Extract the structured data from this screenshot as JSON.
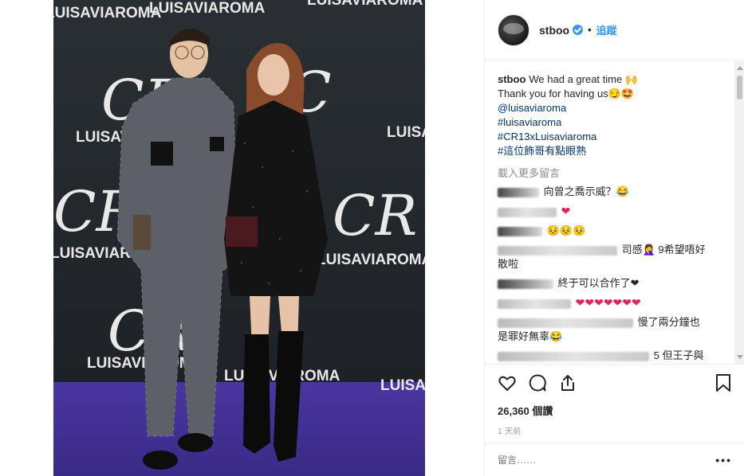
{
  "photo": {
    "brand_text": "LUISAVIAROMA",
    "logo_text": "CR"
  },
  "post": {
    "username": "stboo",
    "separator": "•",
    "follow_label": "追蹤",
    "caption_user": "stboo",
    "caption_line1": "We had a great time 🙌",
    "caption_line2": "Thank you for having us😏🤩",
    "mentions": [
      "@luisaviaroma",
      "#luisaviaroma",
      "#CR13xLuisaviaroma",
      "#這位飾哥有點眼熟"
    ],
    "load_more_label": "載入更多留言"
  },
  "comments": [
    {
      "text": "向曾之喬示威？😂"
    },
    {
      "text": "❤"
    },
    {
      "text": "😣😣😣"
    },
    {
      "text": "司感🤦‍♀️ 9希望唔好",
      "text2": "散啦"
    },
    {
      "text": "終于可以合作了❤"
    },
    {
      "text": "❤❤❤❤❤❤❤"
    },
    {
      "text": "慢了兩分鐘也",
      "text2": "是罪好無辜😂"
    },
    {
      "text": "5 但王子與"
    }
  ],
  "stats": {
    "likes": "26,360 個讚",
    "time": "1 天前"
  },
  "comment_input": {
    "placeholder": "留言……",
    "more_label": "•••"
  },
  "colors": {
    "link": "#003569",
    "follow": "#3897f0",
    "heart": "#e0245e",
    "carpet": "#5b3fb0"
  }
}
